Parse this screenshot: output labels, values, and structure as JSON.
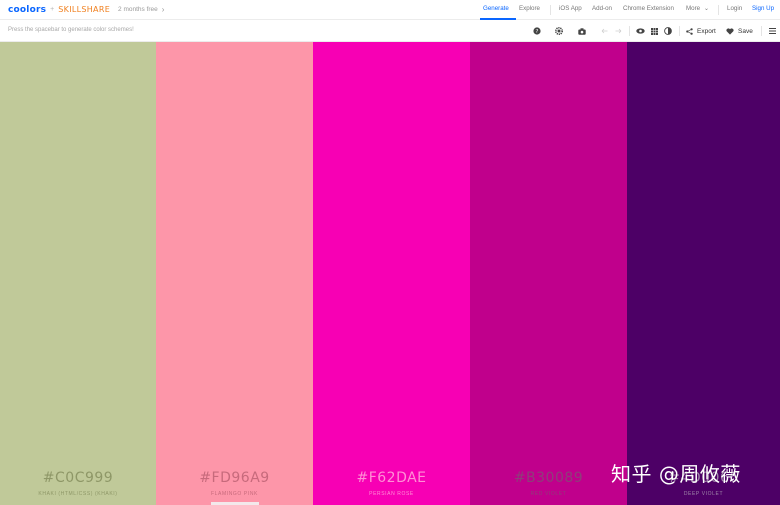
{
  "brand": {
    "logo": "coolors",
    "plus": "+",
    "partner": "SKILLSHARE",
    "promo": "2 months free",
    "promo_chevron": "›"
  },
  "nav": {
    "items": [
      {
        "label": "Generate",
        "active": true
      },
      {
        "label": "Explore"
      },
      {
        "label": "iOS App"
      },
      {
        "label": "Add-on"
      },
      {
        "label": "Chrome Extension"
      },
      {
        "label": "More"
      }
    ],
    "more_chevron": "⌄",
    "login": "Login",
    "signup": "Sign Up"
  },
  "toolbar": {
    "hint": "Press the spacebar to generate color schemes!",
    "tools": [
      "help-icon",
      "gear-icon",
      "camera-icon",
      "undo-icon",
      "redo-icon",
      "eye-icon",
      "grid-icon",
      "contrast-icon",
      "share-icon",
      "heart-icon",
      "menu-icon"
    ],
    "export_label": "Export",
    "save_label": "Save",
    "accent": "#0a66ff"
  },
  "palette": [
    {
      "hex": "#C0C999",
      "name": "KHAKI (HTML/CSS) (KHAKI)",
      "bg": "#C0C999",
      "fg": "#8e9767"
    },
    {
      "hex": "#FD96A9",
      "name": "FLAMINGO PINK",
      "bg": "#FD96A9",
      "fg": "#c76a7c"
    },
    {
      "hex": "#F62DAE",
      "name": "PERSIAN ROSE",
      "bg": "#F700B4",
      "fg": "#ff8fd6"
    },
    {
      "hex": "#B30089",
      "name": "RED VIOLET",
      "bg": "#C0008C",
      "fg": "#8e3e7a"
    },
    {
      "hex": "#4D0066",
      "name": "DEEP VIOLET",
      "bg": "#4D0066",
      "fg": "#9f86a8"
    }
  ],
  "watermark": "知乎 @周攸薇"
}
